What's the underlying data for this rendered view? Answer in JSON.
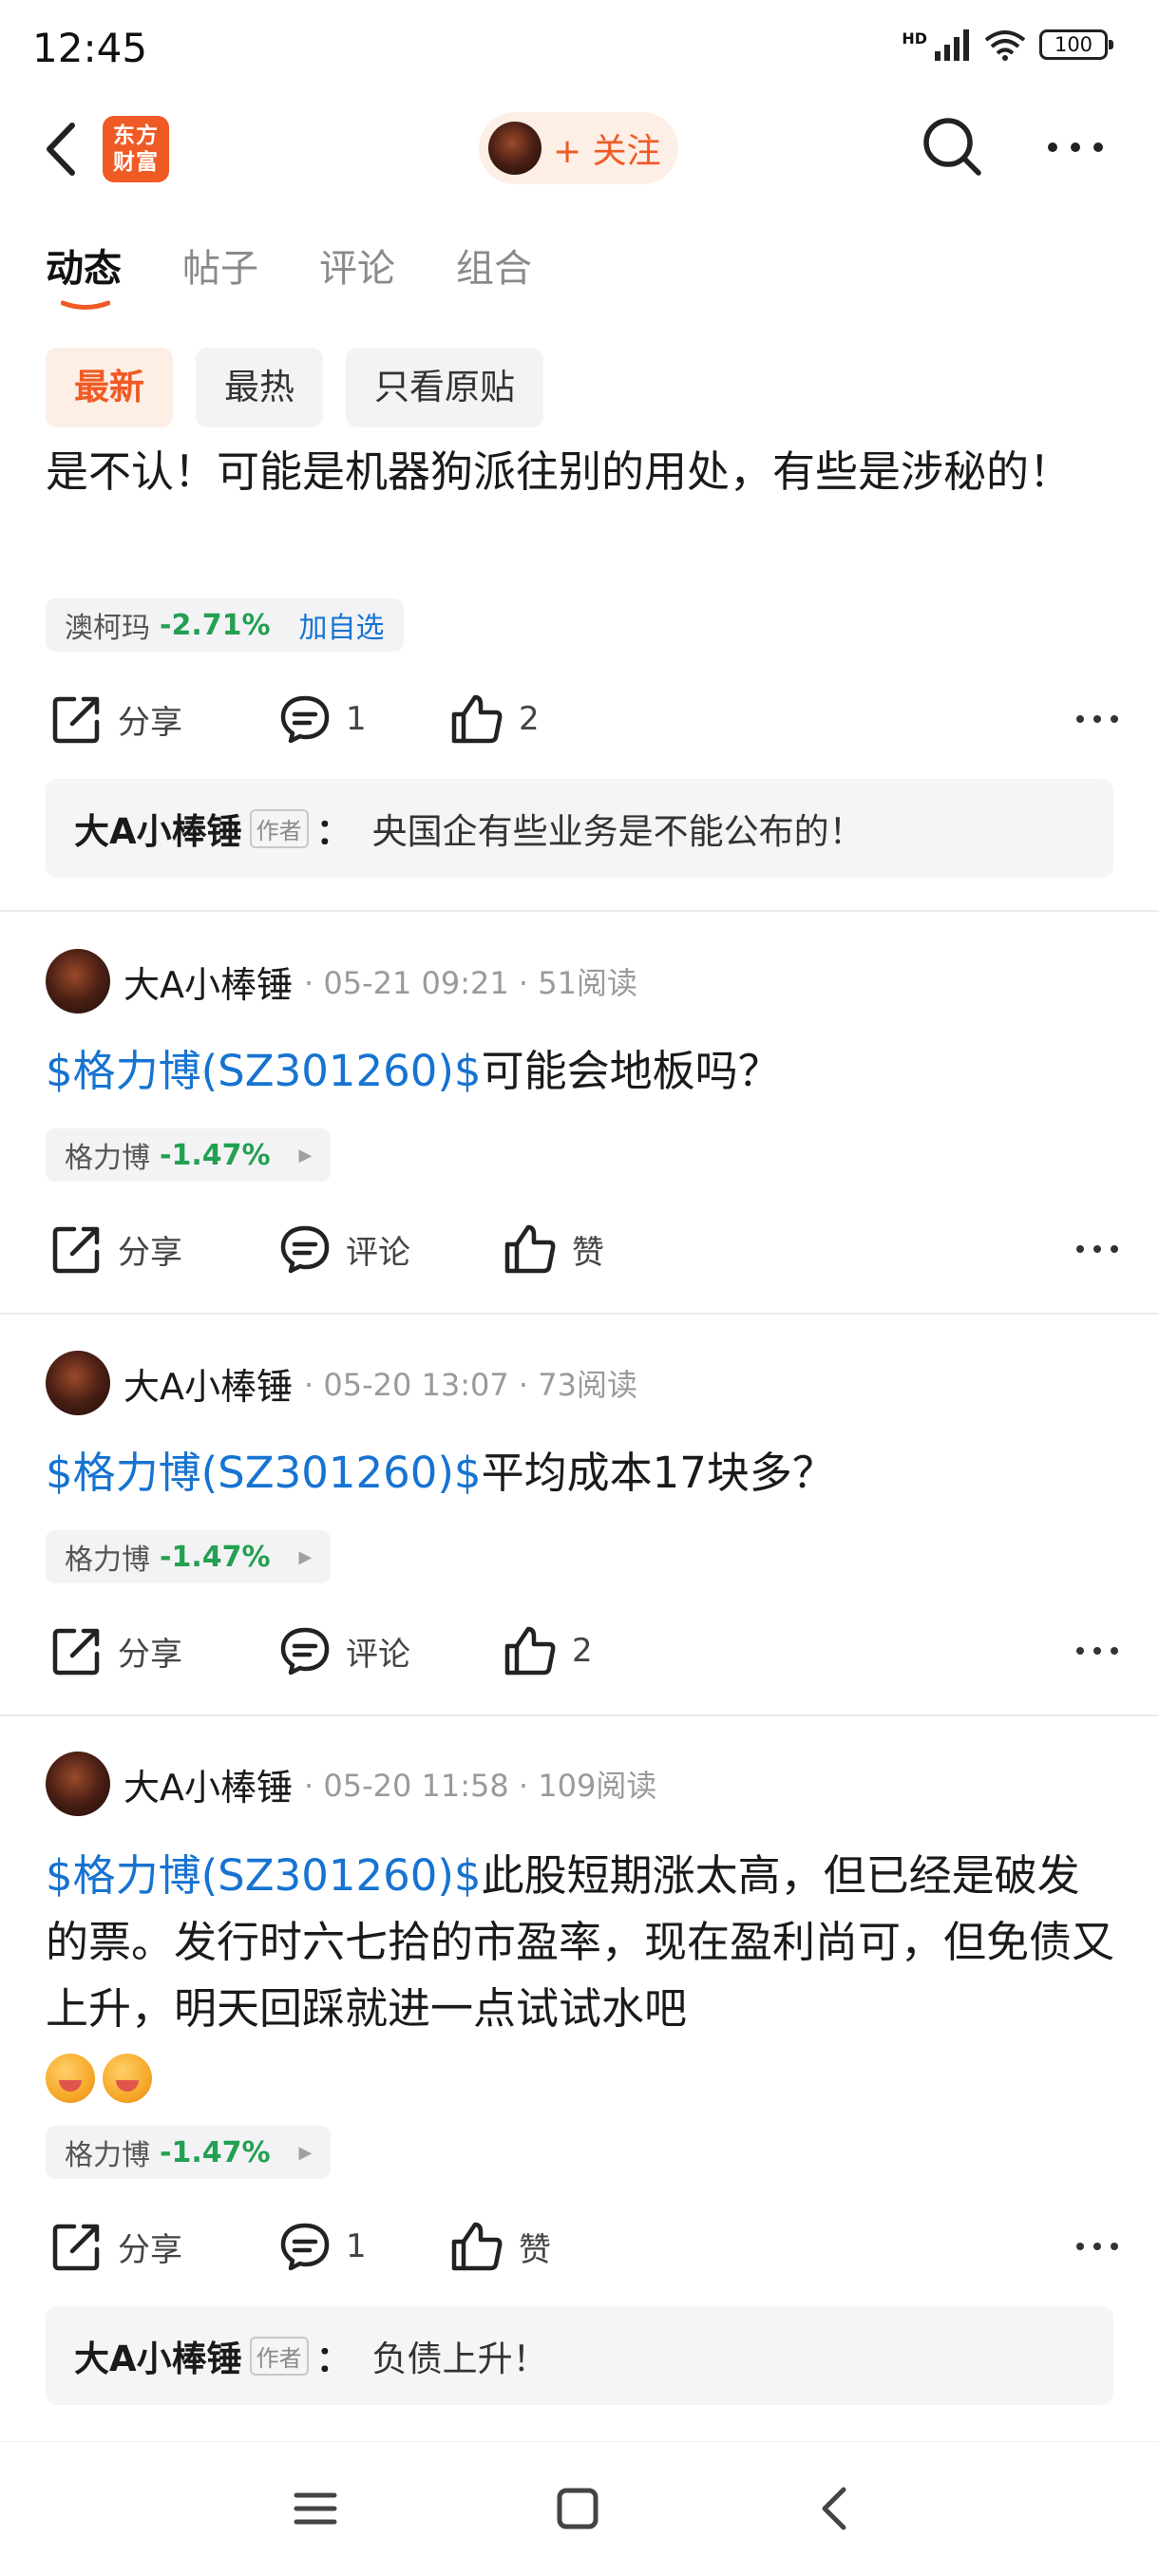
{
  "status": {
    "time": "12:45",
    "hd_label": "HD",
    "battery": "100"
  },
  "nav": {
    "logo_text": "东方财富",
    "follow_label": "+ 关注"
  },
  "tabs": [
    {
      "label": "动态",
      "active": true
    },
    {
      "label": "帖子",
      "active": false
    },
    {
      "label": "评论",
      "active": false
    },
    {
      "label": "组合",
      "active": false
    }
  ],
  "filters": [
    {
      "label": "最新",
      "active": true
    },
    {
      "label": "最热",
      "active": false
    },
    {
      "label": "只看原贴",
      "active": false
    }
  ],
  "post0": {
    "text": "是不认！可能是机器狗派往别的用处，有些是涉秘的！",
    "stock": {
      "name": "澳柯玛",
      "change": "-2.71%",
      "add_label": "加自选"
    },
    "actions": {
      "share": "分享",
      "comments": "1",
      "likes": "2"
    },
    "reply": {
      "name": "大A小棒锤",
      "badge": "作者",
      "colon": "：",
      "text": "央国企有些业务是不能公布的！"
    }
  },
  "posts": [
    {
      "author": "大A小棒锤",
      "meta": "· 05-21 09:21 · 51阅读",
      "link": "$格力博(SZ301260)$",
      "text": "可能会地板吗？",
      "stock": {
        "name": "格力博",
        "change": "-1.47%"
      },
      "actions": {
        "share": "分享",
        "comment": "评论",
        "like": "赞"
      }
    },
    {
      "author": "大A小棒锤",
      "meta": "· 05-20 13:07 · 73阅读",
      "link": "$格力博(SZ301260)$",
      "text": "平均成本17块多？",
      "stock": {
        "name": "格力博",
        "change": "-1.47%"
      },
      "actions": {
        "share": "分享",
        "comment": "评论",
        "like": "2"
      }
    },
    {
      "author": "大A小棒锤",
      "meta": "· 05-20 11:58 · 109阅读",
      "link": "$格力博(SZ301260)$",
      "text": "此股短期涨太高，但已经是破发的票。发行时六七拾的市盈率，现在盈利尚可，但免债又上升，明天回踩就进一点试试水吧",
      "stock": {
        "name": "格力博",
        "change": "-1.47%"
      },
      "actions": {
        "share": "分享",
        "comment": "1",
        "like": "赞"
      },
      "reply": {
        "name": "大A小棒锤",
        "badge": "作者",
        "colon": "：",
        "text": "负债上升！"
      }
    }
  ],
  "colors": {
    "accent": "#f05a24",
    "link": "#1673d1",
    "down_green": "#23a052"
  }
}
